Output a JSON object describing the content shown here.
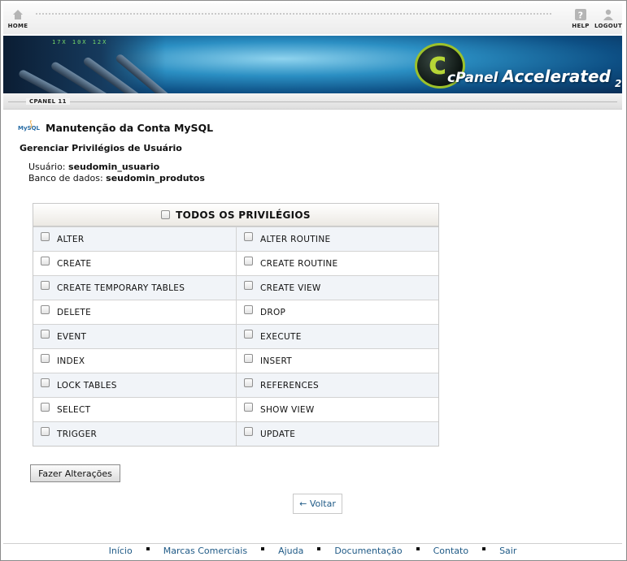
{
  "topbar": {
    "home_label": "HOME",
    "help_label": "HELP",
    "logout_label": "LOGOUT"
  },
  "banner": {
    "numbers": "17X  10X  12X",
    "brand_cpanel": "cPanel",
    "brand_accelerated": "Accelerated",
    "brand_version": "2"
  },
  "subbar": {
    "version_label": "CPANEL 11"
  },
  "page": {
    "title": "Manutenção da Conta MySQL",
    "subtitle": "Gerenciar Privilégios de Usuário",
    "user_label": "Usuário:",
    "user_value": "seudomin_usuario",
    "db_label": "Banco de dados:",
    "db_value": "seudomin_produtos"
  },
  "privileges": {
    "all_label": "TODOS OS PRIVILÉGIOS",
    "rows": [
      [
        "ALTER",
        "ALTER ROUTINE"
      ],
      [
        "CREATE",
        "CREATE ROUTINE"
      ],
      [
        "CREATE TEMPORARY TABLES",
        "CREATE VIEW"
      ],
      [
        "DELETE",
        "DROP"
      ],
      [
        "EVENT",
        "EXECUTE"
      ],
      [
        "INDEX",
        "INSERT"
      ],
      [
        "LOCK TABLES",
        "REFERENCES"
      ],
      [
        "SELECT",
        "SHOW VIEW"
      ],
      [
        "TRIGGER",
        "UPDATE"
      ]
    ]
  },
  "actions": {
    "submit_label": "Fazer Alterações",
    "back_label": "← Voltar"
  },
  "footer": {
    "links": [
      "Início",
      "Marcas Comerciais",
      "Ajuda",
      "Documentação",
      "Contato",
      "Sair"
    ]
  },
  "colors": {
    "link": "#1f5a86",
    "banner_blue": "#2b8fc3",
    "brand_green": "#9cc12a"
  }
}
